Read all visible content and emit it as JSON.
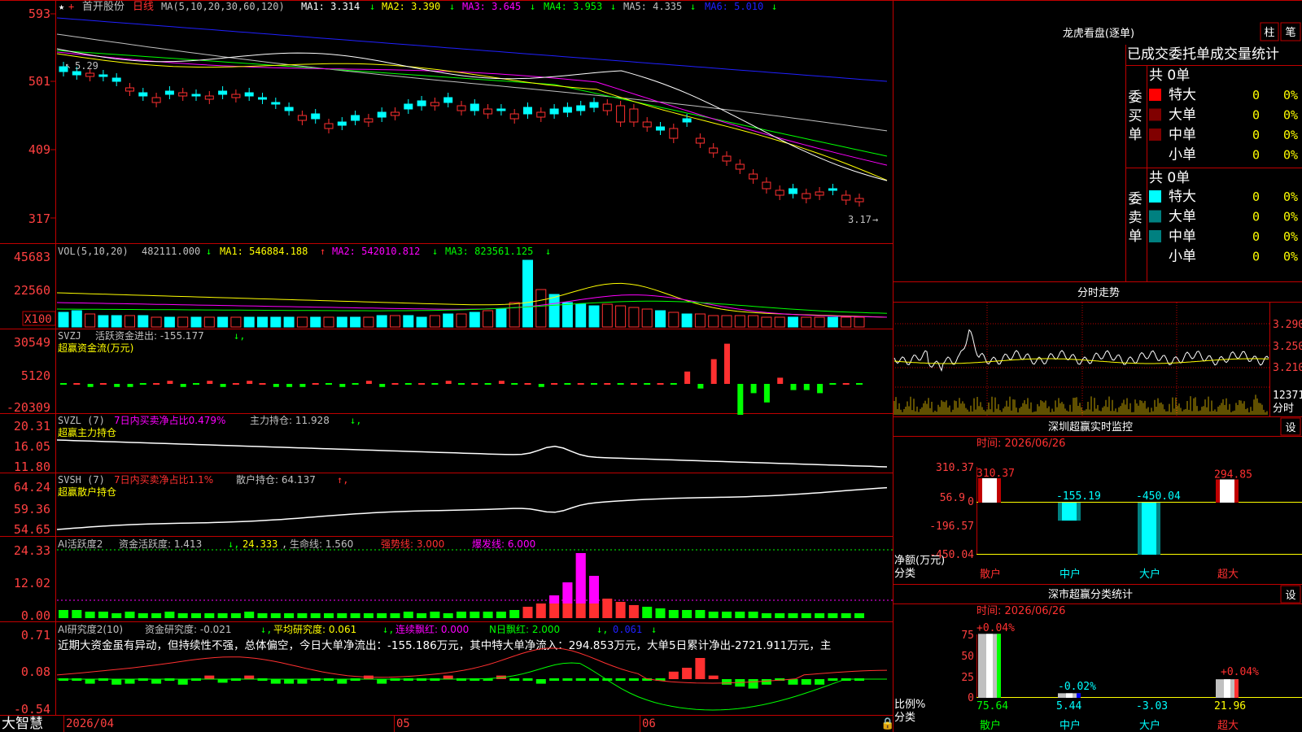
{
  "colors": {
    "up": "#ff3030",
    "down": "#00ffff",
    "frame": "#c00000",
    "axis_text": "#ff4040",
    "ma1": "#ffffff",
    "ma2": "#ffff00",
    "ma3": "#ff00ff",
    "ma4": "#00ff00",
    "ma5": "#c0c0c0",
    "ma6": "#2020ff",
    "green": "#00ff00",
    "cyan": "#00ffff",
    "magenta": "#ff00ff",
    "yellow": "#ffff00",
    "bg": "#000000"
  },
  "price_panel": {
    "stock_name": "首开股份",
    "period": "日线",
    "ma_formula": "MA(5,10,20,30,60,120)",
    "ma1": "MA1: 3.314",
    "ma2": "MA2: 3.390",
    "ma3": "MA3: 3.645",
    "ma4": "MA4: 3.953",
    "ma5": "MA5: 4.335",
    "ma6": "MA6: 5.010",
    "axis": [
      "593",
      "501",
      "409",
      "317"
    ],
    "high_marker": "5.29",
    "low_marker": "3.17"
  },
  "vol_panel": {
    "title": "VOL(5,10,20)",
    "value": "482111.000",
    "ma1": "MA1: 546884.188",
    "ma2": "MA2: 542010.812",
    "ma3": "MA3: 823561.125",
    "axis": [
      "45683",
      "22560"
    ],
    "unit": "X100"
  },
  "svzj_panel": {
    "title": "SVZJ",
    "label": "活跃资金进出: -155.177",
    "subtitle": "超赢资金流(万元)",
    "axis": [
      "30549",
      "5120",
      "-20309"
    ]
  },
  "svzl_panel": {
    "title": "SVZL (7)",
    "ratio": "7日内买卖净占比0.479%",
    "holding": "主力持仓: 11.928",
    "subtitle": "超赢主力持仓",
    "axis": [
      "20.31",
      "16.05",
      "11.80"
    ]
  },
  "svsh_panel": {
    "title": "SVSH (7)",
    "ratio": "7日内买卖净占比1.1%",
    "holding": "散户持仓: 64.137",
    "subtitle": "超赢散户持仓",
    "axis": [
      "64.24",
      "59.36",
      "54.65"
    ]
  },
  "ai1_panel": {
    "title": "AI活跃度2",
    "v1": "资金活跃度: 1.413",
    "v2": "24.333",
    "v3": "生命线: 1.560",
    "v4": "强势线: 3.000",
    "v5": "爆发线: 6.000",
    "axis": [
      "24.33",
      "12.02",
      "0.00"
    ]
  },
  "ai2_panel": {
    "title": "AI研究度2(10)",
    "v1": "资金研究度: -0.021",
    "v2": "平均研究度: 0.061",
    "v3": "连续飘红: 0.000",
    "v4": "N日飘红: 2.000",
    "v5": "0.061",
    "text": "近期大资金虽有异动，但持续性不强，总体偏空，今日大单净流出：-155.186万元，其中特大单净流入：294.853万元，大单5日累计净出-2721.911万元，主",
    "axis": [
      "0.71",
      "0.08",
      "-0.54"
    ]
  },
  "bottom_bar": {
    "brand": "大智慧",
    "dates": [
      "2026/04",
      "05",
      "06"
    ]
  },
  "dragon_tiger": {
    "title": "龙虎看盘(逐单)",
    "btn1": "柱",
    "btn2": "笔",
    "section_title": "已成交委托单成交量统计",
    "buy_label": "委买单",
    "sell_label": "委卖单",
    "buy_total": "共 0单",
    "sell_total": "共 0单",
    "buy_rows": [
      {
        "name": "特大",
        "count": "0",
        "pct": "0%"
      },
      {
        "name": "大单",
        "count": "0",
        "pct": "0%"
      },
      {
        "name": "中单",
        "count": "0",
        "pct": "0%"
      },
      {
        "name": "小单",
        "count": "0",
        "pct": "0%"
      }
    ],
    "sell_rows": [
      {
        "name": "特大",
        "count": "0",
        "pct": "0%"
      },
      {
        "name": "大单",
        "count": "0",
        "pct": "0%"
      },
      {
        "name": "中单",
        "count": "0",
        "pct": "0%"
      },
      {
        "name": "小单",
        "count": "0",
        "pct": "0%"
      }
    ]
  },
  "intraday": {
    "title": "分时走势",
    "axis": [
      "3.290",
      "3.250",
      "3.210"
    ],
    "vol_axis": [
      "12371",
      "分时"
    ]
  },
  "realtime": {
    "title": "深圳超赢实时监控",
    "btn": "设",
    "time": "时间: 2026/06/26",
    "axis": [
      "310.37",
      "56.9",
      "0",
      "-196.57",
      "-450.04"
    ],
    "ylabel": "净额(万元)",
    "xlabel": "分类",
    "categories": [
      "散户",
      "中户",
      "大户",
      "超大"
    ],
    "values": [
      "310.37",
      "-155.19",
      "-450.04",
      "294.85"
    ]
  },
  "classify": {
    "title": "深市超赢分类统计",
    "btn": "设",
    "time": "时间: 2026/06/26",
    "axis": [
      "75",
      "50",
      "25",
      "0"
    ],
    "ylabel": "比例%",
    "xlabel": "分类",
    "categories": [
      "散户",
      "中户",
      "大户",
      "超大"
    ],
    "top_labels": [
      "+0.04%",
      "-0.02%",
      "+0.04%"
    ],
    "values": [
      "75.64",
      "5.44",
      "-3.03",
      "21.96"
    ]
  }
}
